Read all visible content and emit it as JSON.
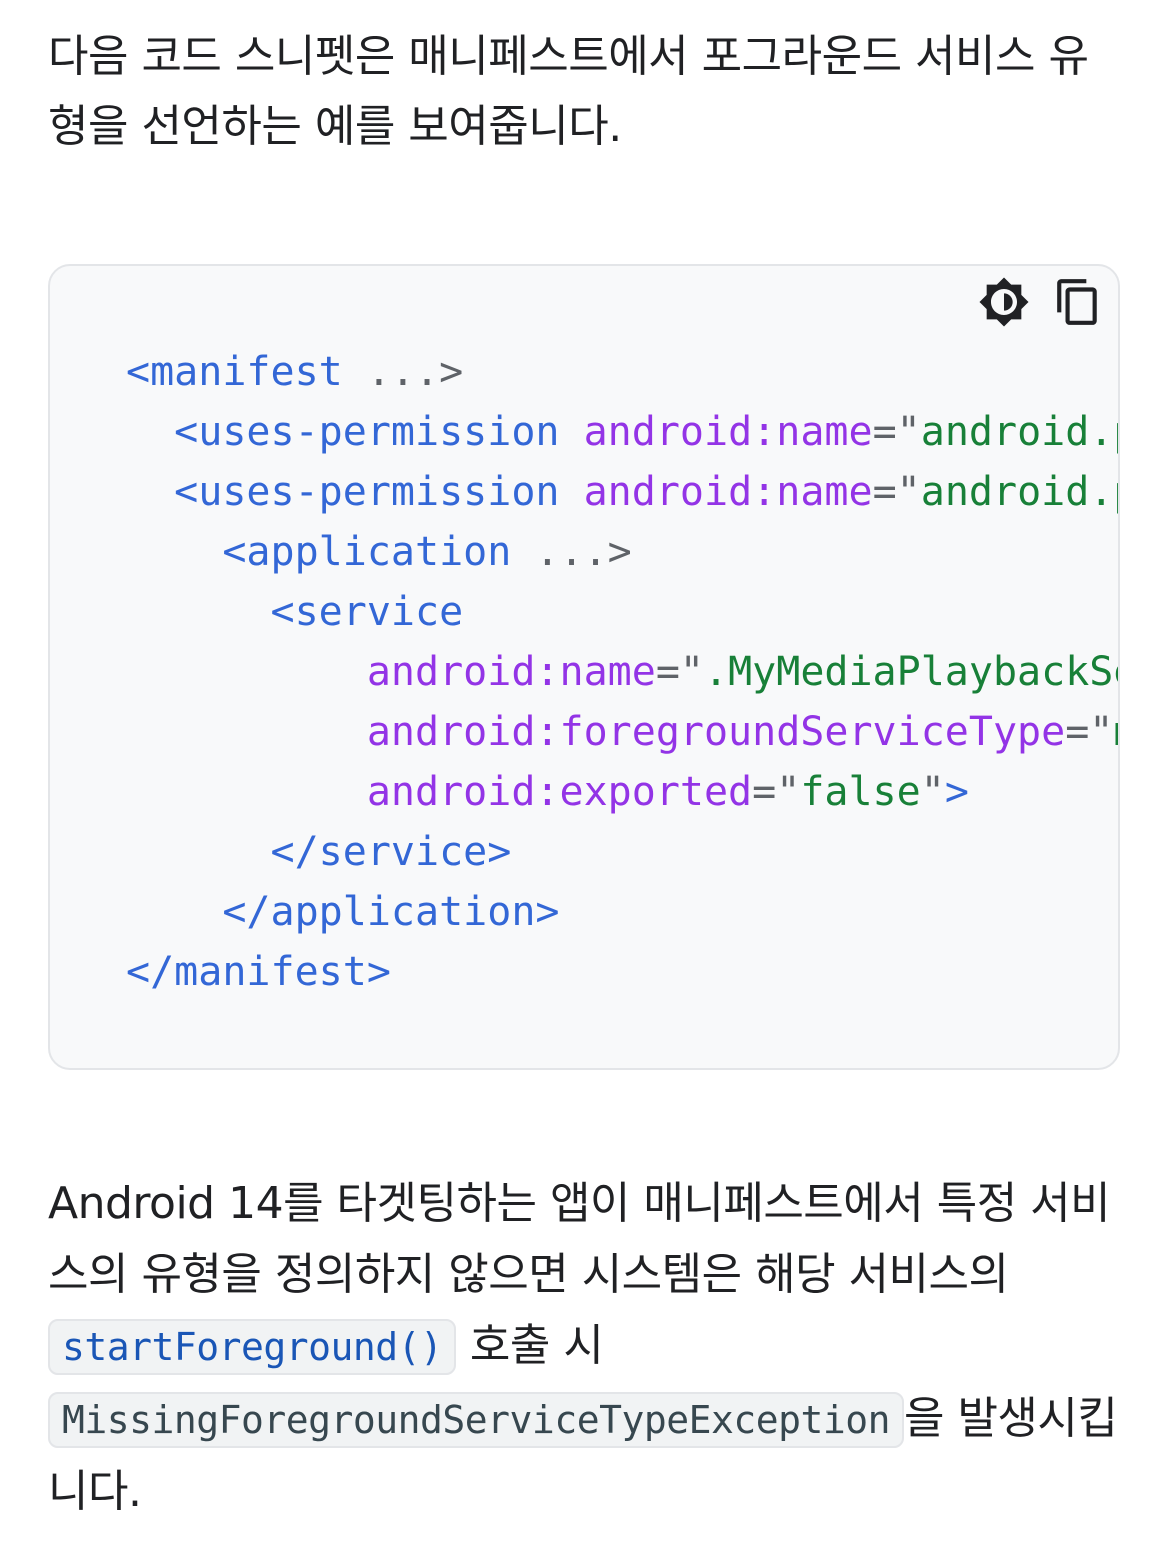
{
  "intro": {
    "text": "다음 코드 스니펫은 매니페스트에서 포그라운드 서비스 유형을 선언하는 예를 보여줍니다."
  },
  "code_block": {
    "toolbar": {
      "theme_icon": "brightness-theme-icon",
      "copy_icon": "copy-icon"
    },
    "lines": [
      {
        "indent": "",
        "parts": [
          {
            "cls": "tag",
            "t": "<manifest"
          },
          {
            "cls": "plain",
            "t": " ...>"
          }
        ]
      },
      {
        "indent": "  ",
        "parts": [
          {
            "cls": "tag",
            "t": "<uses-permission"
          },
          {
            "cls": "plain",
            "t": " "
          },
          {
            "cls": "attr",
            "t": "android:name"
          },
          {
            "cls": "plain",
            "t": "=\""
          },
          {
            "cls": "str",
            "t": "android.permission.FOREGROUND_SERVICE"
          },
          {
            "cls": "plain",
            "t": "\""
          },
          {
            "cls": "tag",
            "t": "/>"
          }
        ]
      },
      {
        "indent": "  ",
        "parts": [
          {
            "cls": "tag",
            "t": "<uses-permission"
          },
          {
            "cls": "plain",
            "t": " "
          },
          {
            "cls": "attr",
            "t": "android:name"
          },
          {
            "cls": "plain",
            "t": "=\""
          },
          {
            "cls": "str",
            "t": "android.permission.FOREGROUND_SERVICE_MEDIA_PLAYBACK"
          },
          {
            "cls": "plain",
            "t": "\""
          },
          {
            "cls": "tag",
            "t": "/>"
          }
        ]
      },
      {
        "indent": "    ",
        "parts": [
          {
            "cls": "tag",
            "t": "<application"
          },
          {
            "cls": "plain",
            "t": " ...>"
          }
        ]
      },
      {
        "indent": "      ",
        "parts": [
          {
            "cls": "tag",
            "t": "<service"
          }
        ]
      },
      {
        "indent": "          ",
        "parts": [
          {
            "cls": "attr",
            "t": "android:name"
          },
          {
            "cls": "plain",
            "t": "=\""
          },
          {
            "cls": "str",
            "t": ".MyMediaPlaybackService"
          },
          {
            "cls": "plain",
            "t": "\""
          }
        ]
      },
      {
        "indent": "          ",
        "parts": [
          {
            "cls": "attr",
            "t": "android:foregroundServiceType"
          },
          {
            "cls": "plain",
            "t": "=\""
          },
          {
            "cls": "str",
            "t": "mediaPlayback"
          },
          {
            "cls": "plain",
            "t": "\""
          }
        ]
      },
      {
        "indent": "          ",
        "parts": [
          {
            "cls": "attr",
            "t": "android:exported"
          },
          {
            "cls": "plain",
            "t": "=\""
          },
          {
            "cls": "str",
            "t": "false"
          },
          {
            "cls": "plain",
            "t": "\""
          },
          {
            "cls": "tag",
            "t": ">"
          }
        ]
      },
      {
        "indent": "      ",
        "parts": [
          {
            "cls": "tag",
            "t": "</service>"
          }
        ]
      },
      {
        "indent": "    ",
        "parts": [
          {
            "cls": "tag",
            "t": "</application>"
          }
        ]
      },
      {
        "indent": "",
        "parts": [
          {
            "cls": "tag",
            "t": "</manifest>"
          }
        ]
      }
    ]
  },
  "body": {
    "text_before": "Android 14를 타겟팅하는 앱이 매니페스트에서 특정 서비스의 유형을 정의하지 않으면 시스템은 해당 서비스의 ",
    "code1": "startForeground()",
    "text_mid": " 호출 시 ",
    "code2": "MissingForegroundServiceTypeException",
    "text_after": "을 발생시킵니다."
  },
  "colors": {
    "tag": "#3367d6",
    "attr": "#9334e6",
    "string": "#188038",
    "punct": "#5f6368",
    "code_bg": "#f8f9fa"
  }
}
